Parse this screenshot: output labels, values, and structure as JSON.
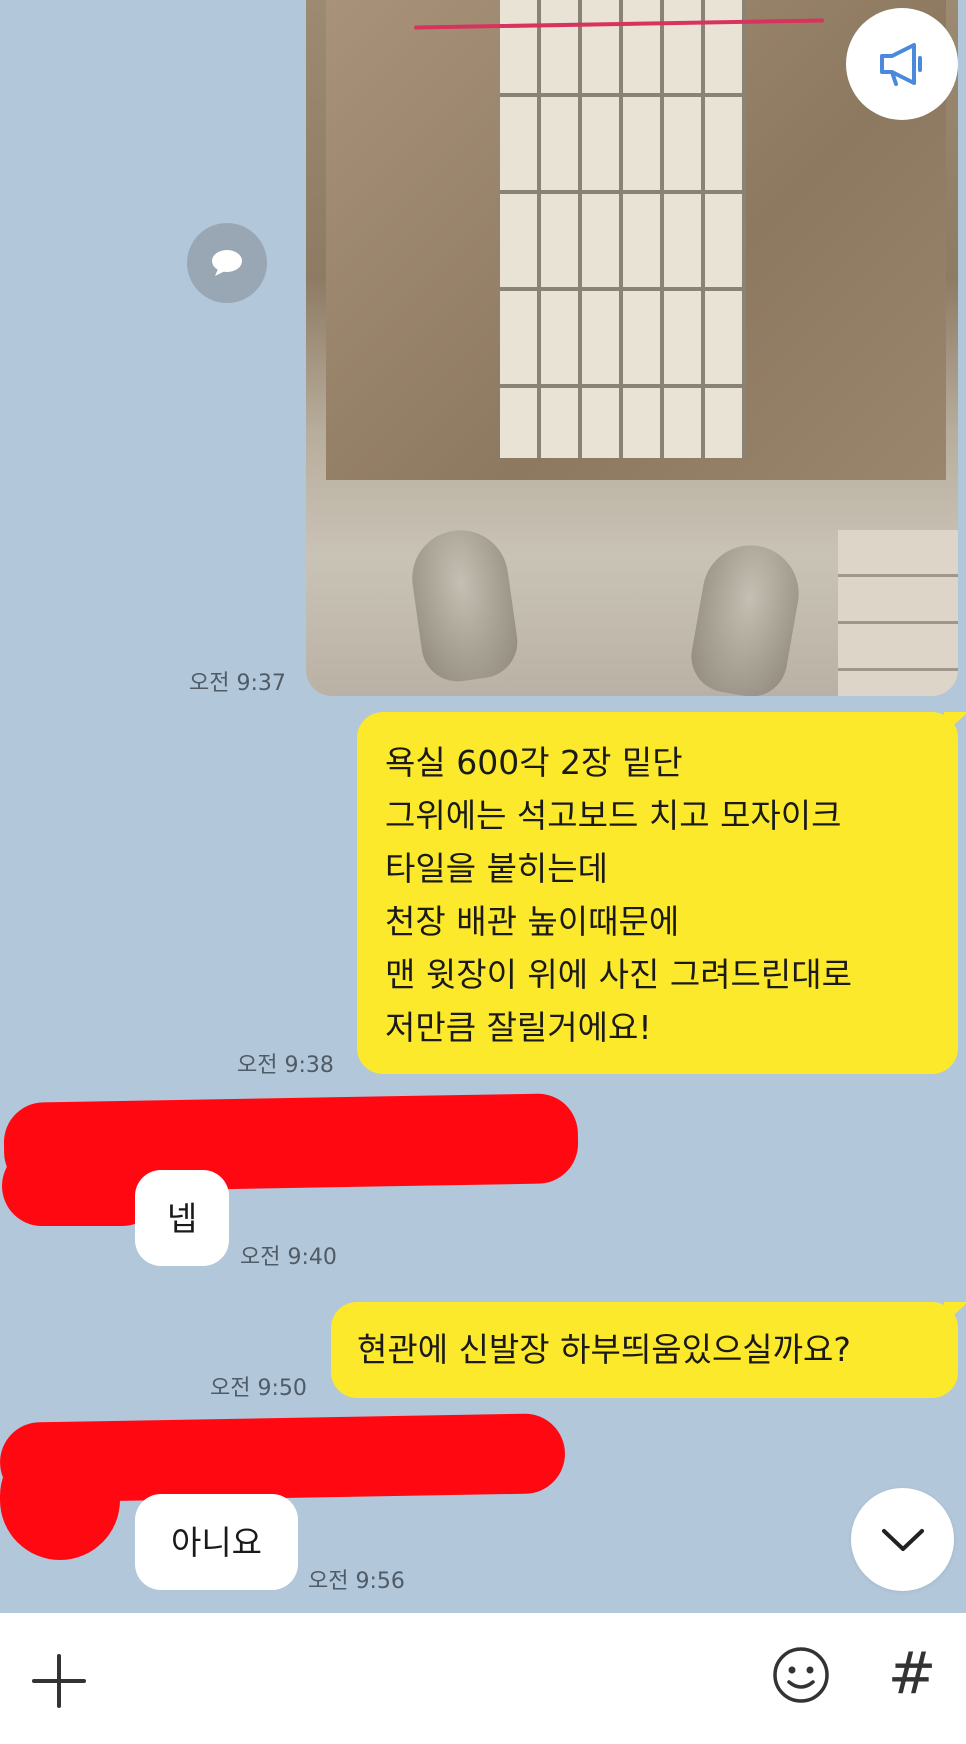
{
  "messages": [
    {
      "type": "image",
      "side": "mine",
      "time": "오전 9:37"
    },
    {
      "type": "text",
      "side": "mine",
      "time": "오전 9:38",
      "lines": [
        "욕실 600각 2장 밑단",
        "그위에는 석고보드 치고 모자이크",
        "타일을 붙히는데",
        "천장 배관 높이때문에",
        "맨 윗장이 위에 사진 그려드린대로",
        "저만큼 잘릴거에요!"
      ]
    },
    {
      "type": "text",
      "side": "theirs",
      "time": "오전 9:40",
      "text": "넵"
    },
    {
      "type": "text",
      "side": "mine",
      "time": "오전 9:50",
      "text": "현관에 신발장 하부띄움있으실까요?"
    },
    {
      "type": "text",
      "side": "theirs",
      "time": "오전 9:56",
      "text": "아니요"
    }
  ],
  "icons": {
    "megaphone": "megaphone-icon",
    "share": "speech-bubble-icon",
    "scroll_down": "chevron-down-icon",
    "attach": "plus-icon",
    "emoji": "smiley-icon",
    "hashtag": "hash-icon"
  },
  "input_bar": {
    "hash_symbol": "#"
  },
  "colors": {
    "background": "#b2c7da",
    "my_bubble": "#fde92c",
    "their_bubble": "#ffffff",
    "redaction": "#ff0812"
  }
}
